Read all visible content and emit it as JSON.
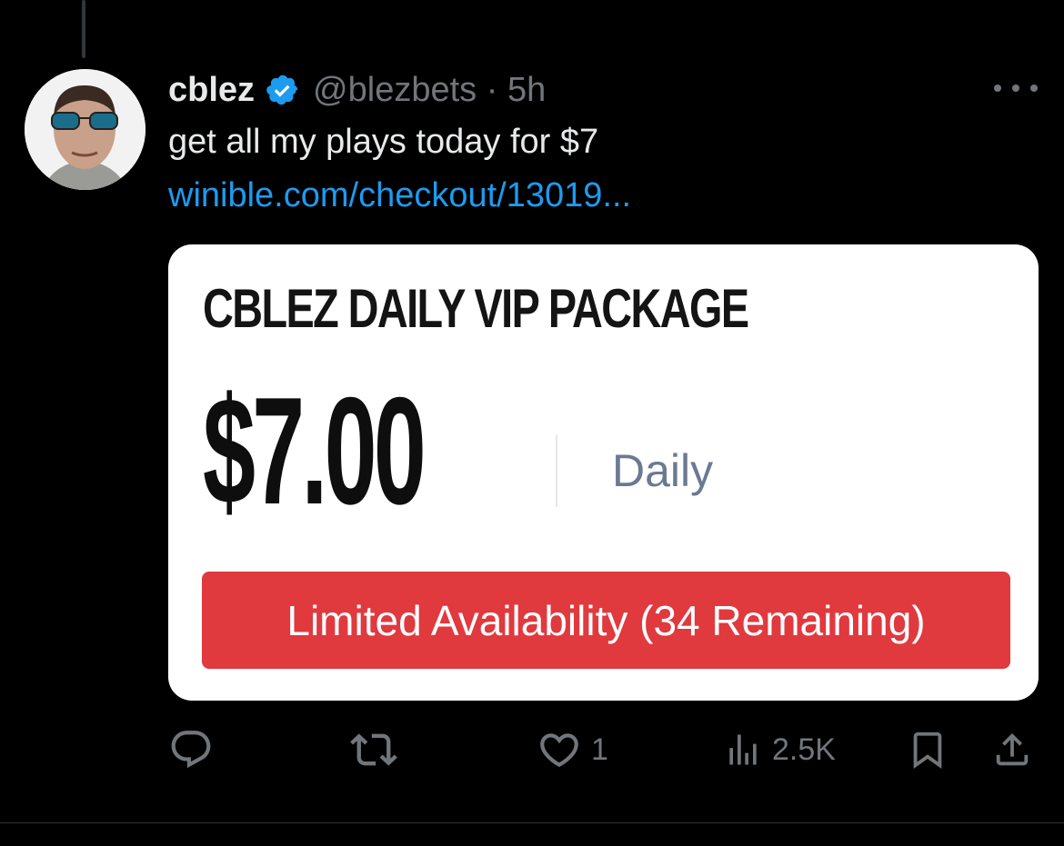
{
  "author": {
    "name": "cblez",
    "handle": "@blezbets",
    "time": "5h",
    "verified": true
  },
  "tweet": {
    "text": "get all my plays today for $7",
    "link": "winible.com/checkout/13019..."
  },
  "card": {
    "title": "CBLEZ DAILY VIP PACKAGE",
    "price": "$7.00",
    "period": "Daily",
    "availability": "Limited Availability (34 Remaining)"
  },
  "actions": {
    "replies": "",
    "reposts": "",
    "likes": "1",
    "views": "2.5K"
  },
  "colors": {
    "background": "#000000",
    "link": "#1d9bf0",
    "verified_badge": "#1d9bf0",
    "muted": "#71767b",
    "availability_banner": "#e0393e"
  },
  "icons": [
    "reply-icon",
    "repost-icon",
    "like-icon",
    "views-icon",
    "bookmark-icon",
    "share-icon",
    "more-icon",
    "verified-badge-icon"
  ]
}
